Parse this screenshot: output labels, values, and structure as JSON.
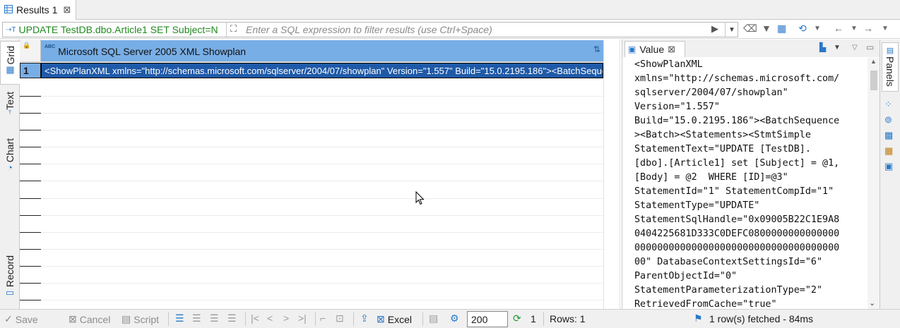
{
  "tab": {
    "label": "Results 1",
    "close": "⊠"
  },
  "filter": {
    "query": "UPDATE TestDB.dbo.Article1 SET Subject=N",
    "placeholder": "Enter a SQL expression to filter results (use Ctrl+Space)"
  },
  "left_tabs": [
    {
      "label": "Grid"
    },
    {
      "label": "Text"
    },
    {
      "label": "Chart"
    },
    {
      "label": "Record"
    }
  ],
  "grid": {
    "column_header": "Microsoft SQL Server 2005 XML Showplan",
    "type_badge": "ABC",
    "rows": [
      {
        "num": "1",
        "value": "<ShowPlanXML xmlns=\"http://schemas.microsoft.com/sqlserver/2004/07/showplan\" Version=\"1.557\" Build=\"15.0.2195.186\"><BatchSequence><Batch><Statements>"
      }
    ]
  },
  "value_panel": {
    "tab_label": "Value",
    "lines": [
      "<ShowPlanXML",
      "xmlns=\"http://schemas.microsoft.com/",
      "sqlserver/2004/07/showplan\"",
      "Version=\"1.557\"",
      "Build=\"15.0.2195.186\"><BatchSequence",
      "><Batch><Statements><StmtSimple",
      "StatementText=\"UPDATE [TestDB].",
      "[dbo].[Article1] set [Subject] = @1,",
      "[Body] = @2  WHERE [ID]=@3\"",
      "StatementId=\"1\" StatementCompId=\"1\"",
      "StatementType=\"UPDATE\"",
      "StatementSqlHandle=\"0x09005B22C1E9A8",
      "0404225681D333C0DEFC0800000000000000",
      "000000000000000000000000000000000000",
      "00\" DatabaseContextSettingsId=\"6\"",
      "ParentObjectId=\"0\"",
      "StatementParameterizationType=\"2\"",
      "RetrievedFromCache=\"true\""
    ]
  },
  "right_sidebar": {
    "panels_label": "Panels"
  },
  "bottom": {
    "save": "Save",
    "cancel": "Cancel",
    "script": "Script",
    "excel": "Excel",
    "fetch_size": "200",
    "refresh_count": "1",
    "rows": "Rows: 1",
    "status": "1 row(s) fetched - 84ms"
  },
  "colors": {
    "header_blue": "#78aee6",
    "selection_blue": "#1f5aa8",
    "query_green": "#1f8a1f",
    "icon_blue": "#2a78c8"
  }
}
